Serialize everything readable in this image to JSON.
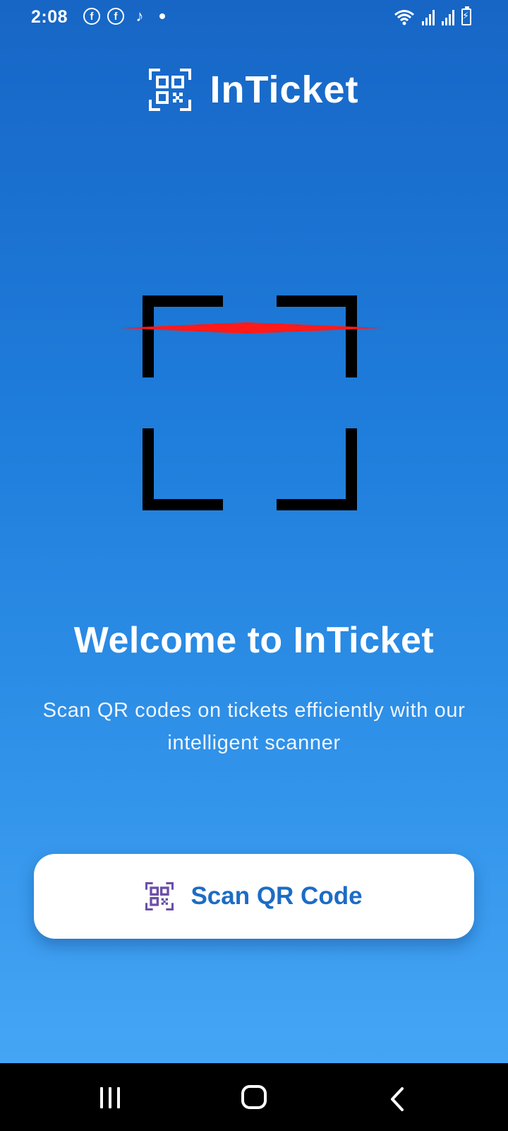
{
  "status_bar": {
    "time": "2:08",
    "app_icons": [
      "facebook-icon",
      "facebook-icon",
      "tiktok-icon",
      "notification-dot-icon"
    ],
    "facebook_glyph": "f",
    "tiktok_glyph": "♪",
    "right_icons": [
      "wifi-icon",
      "signal-icon",
      "signal-icon",
      "battery-charging-icon"
    ]
  },
  "header": {
    "app_name": "InTicket",
    "logo_icon": "qr-code-icon"
  },
  "scanner": {
    "frame_color": "#000000",
    "laser_color": "#ff1a1a"
  },
  "welcome": {
    "title": "Welcome to InTicket",
    "subtitle": "Scan QR codes on tickets efficiently with our intelligent scanner"
  },
  "scan_button": {
    "label": "Scan QR Code",
    "icon": "qr-code-icon",
    "icon_color": "#6b4fa6",
    "label_color": "#1c6cc5"
  },
  "nav_bar": {
    "items": [
      "recents-icon",
      "home-icon",
      "back-icon"
    ]
  },
  "colors": {
    "gradient_top": "#1766c6",
    "gradient_bottom": "#45a5f5",
    "button_bg": "#ffffff"
  }
}
